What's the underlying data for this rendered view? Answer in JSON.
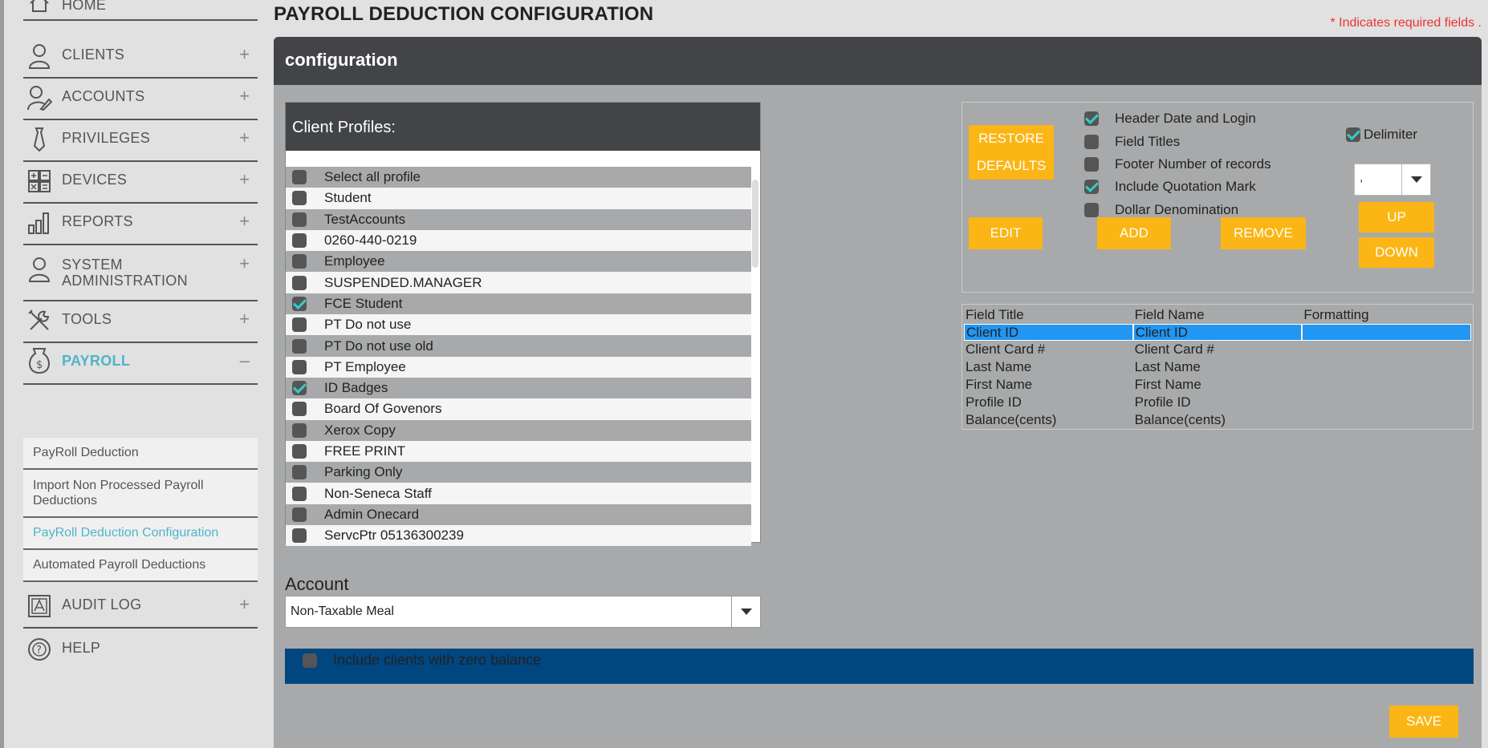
{
  "page": {
    "title": "PAYROLL DEDUCTION CONFIGURATION",
    "required_note": "* Indicates required fields ."
  },
  "sidebar": {
    "items": [
      {
        "label": "HOME",
        "icon": "home-icon"
      },
      {
        "label": "CLIENTS",
        "icon": "user-icon",
        "expand": "+"
      },
      {
        "label": "ACCOUNTS",
        "icon": "user-edit-icon",
        "expand": "+"
      },
      {
        "label": "PRIVILEGES",
        "icon": "tie-icon",
        "expand": "+"
      },
      {
        "label": "DEVICES",
        "icon": "calculator-icon",
        "expand": "+"
      },
      {
        "label": "REPORTS",
        "icon": "bar-chart-icon",
        "expand": "+"
      },
      {
        "label": "SYSTEM ADMINISTRATION",
        "icon": "admin-user-icon",
        "expand": "+"
      },
      {
        "label": "TOOLS",
        "icon": "tools-icon",
        "expand": "+"
      },
      {
        "label": "PAYROLL",
        "icon": "money-bag-icon",
        "expand": "–"
      },
      {
        "label": "AUDIT LOG",
        "icon": "audit-icon",
        "expand": "+"
      },
      {
        "label": "HELP",
        "icon": "help-icon"
      }
    ],
    "payroll_sub": [
      "PayRoll Deduction",
      "Import Non Processed Payroll Deductions",
      "PayRoll Deduction Configuration",
      "Automated Payroll Deductions"
    ]
  },
  "panel": {
    "title": "configuration",
    "profiles_title": "Client Profiles:",
    "profiles": [
      {
        "label": "Select all profile",
        "checked": false
      },
      {
        "label": "Student",
        "checked": false
      },
      {
        "label": "TestAccounts",
        "checked": false
      },
      {
        "label": "0260-440-0219",
        "checked": false
      },
      {
        "label": "Employee",
        "checked": false
      },
      {
        "label": "SUSPENDED.MANAGER",
        "checked": false
      },
      {
        "label": "FCE Student",
        "checked": true
      },
      {
        "label": "PT Do not use",
        "checked": false
      },
      {
        "label": "PT Do not use old",
        "checked": false
      },
      {
        "label": "PT Employee",
        "checked": false
      },
      {
        "label": "ID Badges",
        "checked": true
      },
      {
        "label": "Board Of Govenors",
        "checked": false
      },
      {
        "label": "Xerox Copy",
        "checked": false
      },
      {
        "label": "FREE PRINT",
        "checked": false
      },
      {
        "label": "Parking Only",
        "checked": false
      },
      {
        "label": "Non-Seneca Staff",
        "checked": false
      },
      {
        "label": "Admin Onecard",
        "checked": false
      },
      {
        "label": "ServcPtr 05136300239",
        "checked": false
      }
    ],
    "account_label": "Account",
    "account_value": "Non-Taxable Meal",
    "zero_balance_label": "Include clients with zero balance",
    "save_label": "SAVE"
  },
  "options": {
    "restore_1": "RESTORE",
    "restore_2": "DEFAULTS",
    "checks": [
      {
        "label": "Header Date and Login",
        "checked": true
      },
      {
        "label": "Field Titles",
        "checked": false
      },
      {
        "label": "Footer Number of records",
        "checked": false
      },
      {
        "label": "Include Quotation Mark",
        "checked": true
      },
      {
        "label": "Dollar Denomination",
        "checked": false
      }
    ],
    "delimiter_label": "Delimiter",
    "delimiter_value": ",",
    "edit": "EDIT",
    "add": "ADD",
    "remove": "REMOVE",
    "up": "UP",
    "down": "DOWN"
  },
  "fields": {
    "headers": [
      "Field Title",
      "Field Name",
      "Formatting"
    ],
    "rows": [
      [
        "Client ID",
        "Client ID",
        ""
      ],
      [
        "Client Card #",
        "Client Card #",
        ""
      ],
      [
        "Last Name",
        "Last Name",
        ""
      ],
      [
        "First Name",
        "First Name",
        ""
      ],
      [
        "Profile ID",
        "Profile ID",
        ""
      ],
      [
        "Balance(cents)",
        "Balance(cents)",
        ""
      ]
    ]
  },
  "colors": {
    "accent": "#4fb5c8",
    "button": "#fbb514",
    "header": "#434448",
    "selection": "#2196f3",
    "bar": "#004680"
  }
}
